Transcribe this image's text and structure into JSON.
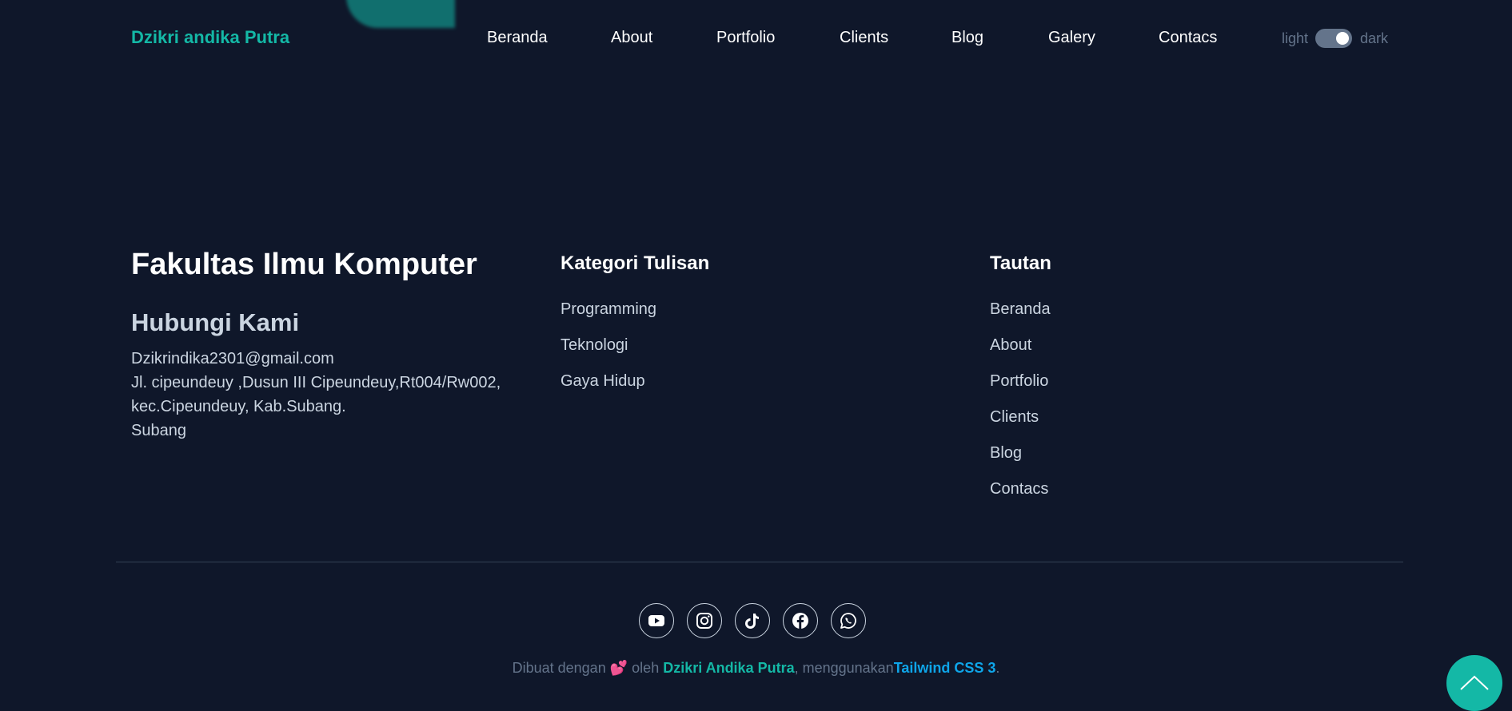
{
  "header": {
    "brand": "Dzikri andika Putra",
    "nav": [
      {
        "label": "Beranda"
      },
      {
        "label": "About"
      },
      {
        "label": "Portfolio"
      },
      {
        "label": "Clients"
      },
      {
        "label": "Blog"
      },
      {
        "label": "Galery"
      },
      {
        "label": "Contacs"
      }
    ],
    "theme_toggle": {
      "light_label": "light",
      "dark_label": "dark",
      "state": "dark"
    }
  },
  "footer": {
    "org_title": "Fakultas Ilmu Komputer",
    "contact": {
      "title": "Hubungi Kami",
      "email": "Dzikrindika2301@gmail.com",
      "address_line1": "Jl. cipeundeuy ,Dusun III Cipeundeuy,Rt004/Rw002,",
      "address_line2": "kec.Cipeundeuy, Kab.Subang.",
      "city": "Subang"
    },
    "categories": {
      "title": "Kategori Tulisan",
      "items": [
        "Programming",
        "Teknologi",
        "Gaya Hidup"
      ]
    },
    "links": {
      "title": "Tautan",
      "items": [
        "Beranda",
        "About",
        "Portfolio",
        "Clients",
        "Blog",
        "Contacs"
      ]
    },
    "socials": [
      "youtube-icon",
      "instagram-icon",
      "tiktok-icon",
      "facebook-icon",
      "whatsapp-icon"
    ],
    "credit": {
      "prefix": "Dibuat dengan",
      "heart": "💕",
      "by": "oleh",
      "author": "Dzikri Andika Putra",
      "using": ", menggunakan",
      "tech": "Tailwind CSS 3",
      "suffix": "."
    }
  },
  "colors": {
    "background": "#0f172a",
    "accent": "#14b8a6",
    "link_blue": "#0ea5e9",
    "muted": "#64748b"
  }
}
